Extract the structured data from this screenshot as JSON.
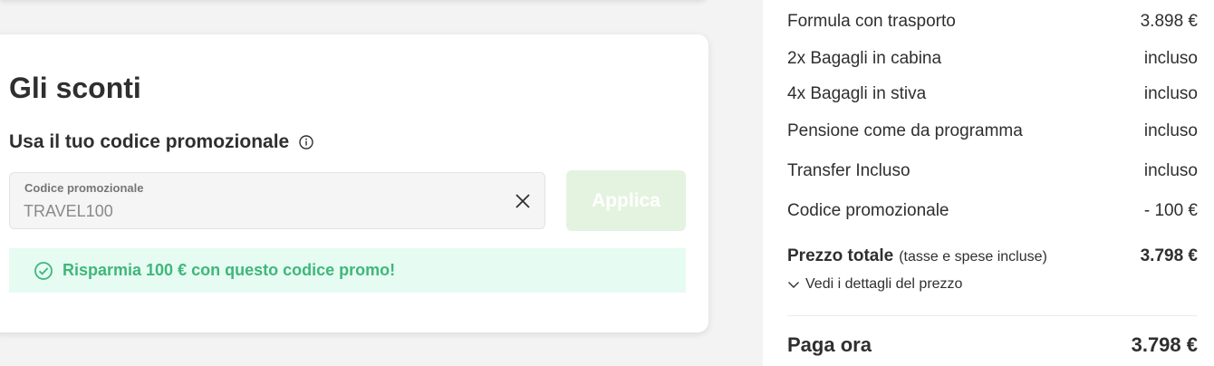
{
  "discount": {
    "title": "Gli sconti",
    "subtitle": "Usa il tuo codice promozionale",
    "field_label": "Codice promozionale",
    "field_value": "TRAVEL100",
    "apply_label": "Applica",
    "success_message": "Risparmia 100 € con questo codice promo!"
  },
  "summary": {
    "rows": [
      {
        "label": "Formula con trasporto",
        "value": "3.898 €"
      },
      {
        "label": "2x Bagagli in cabina",
        "value": "incluso"
      },
      {
        "label": "4x Bagagli in stiva",
        "value": "incluso"
      },
      {
        "label": "Pensione come da programma",
        "value": "incluso"
      },
      {
        "label": "Transfer Incluso",
        "value": "incluso"
      },
      {
        "label": "Codice promozionale",
        "value": "- 100 €"
      }
    ],
    "total_label": "Prezzo totale",
    "total_note": "(tasse e spese incluse)",
    "total_value": "3.798 €",
    "details_link": "Vedi i dettagli del prezzo",
    "pay_label": "Paga ora",
    "pay_value": "3.798 €"
  },
  "colors": {
    "success_green": "#3fb77a",
    "success_bg": "#e6fbf2",
    "apply_disabled_bg": "#e4f3df"
  },
  "icons": [
    "info-icon",
    "close-icon",
    "check-circle-icon",
    "chevron-down-icon"
  ]
}
